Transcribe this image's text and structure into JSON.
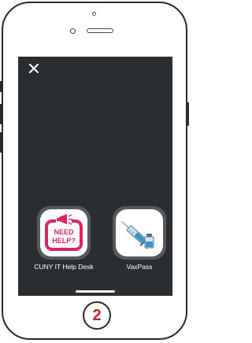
{
  "screen": {
    "close_icon": "close-icon",
    "background_color": "#2b2e31"
  },
  "apps": [
    {
      "label": "CUNY IT Help Desk",
      "icon": "megaphone-need-help-icon",
      "icon_text": "NEED HELP?",
      "accent_color": "#e0245e"
    },
    {
      "label": "VaxPass",
      "icon": "vaccine-syringe-icon"
    }
  ],
  "home_button": {
    "step_number": "2",
    "color": "#c0262d"
  }
}
